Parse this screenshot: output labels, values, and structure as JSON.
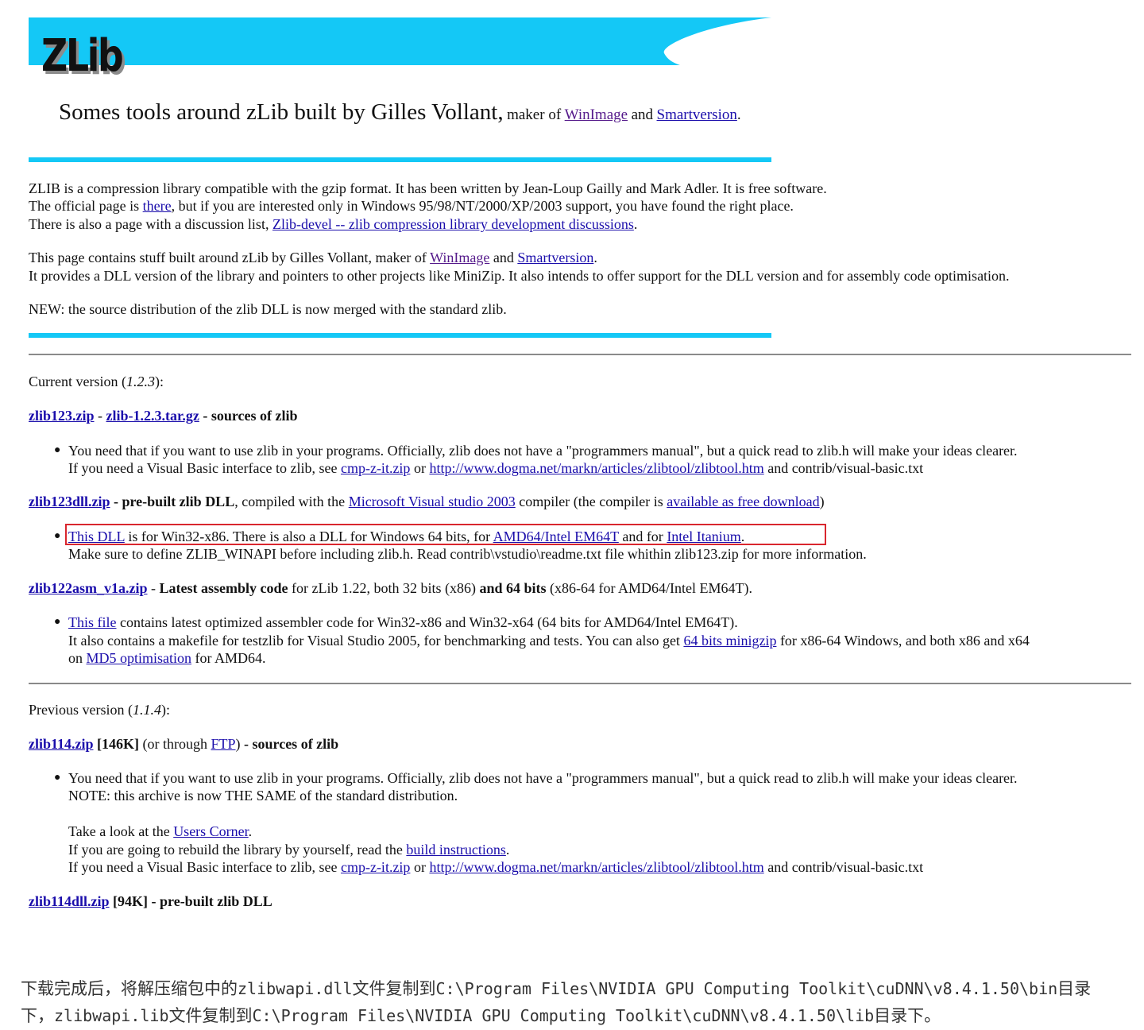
{
  "banner": {
    "logo_text": "ZLib",
    "tagline_large": "Somes tools around zLib built by Gilles Vollant,",
    "tagline_small": "maker of",
    "winimage": "WinImage",
    "and": "and",
    "smartversion": "Smartversion",
    "period": "."
  },
  "intro": {
    "p1": "ZLIB is a compression library compatible with the gzip format. It has been written by Jean-Loup Gailly and Mark Adler. It is free software.",
    "p2_a": "The official page is ",
    "p2_link": "there",
    "p2_b": ", but if you are interested only in Windows 95/98/NT/2000/XP/2003 support, you have found the right place.",
    "p3_a": "There is also a page with a discussion list, ",
    "p3_link": "Zlib-devel -- zlib compression library development discussions",
    "p3_b": ".",
    "p4_a": "This page contains stuff built around zLib by Gilles Vollant, maker of ",
    "p4_link1": "WinImage",
    "p4_and": " and ",
    "p4_link2": "Smartversion",
    "p4_b": ".",
    "p5": "It provides a DLL version of the library and pointers to other projects like MiniZip. It also intends to offer support for the DLL version and for assembly code optimisation.",
    "p6": "NEW: the source distribution of the zlib DLL is now merged with the standard zlib."
  },
  "current": {
    "heading_a": "Current version (",
    "version": "1.2.3",
    "heading_b": "):",
    "src": {
      "link1": "zlib123.zip",
      "sep": " - ",
      "link2": "zlib-1.2.3.tar.gz",
      "desc": " - sources of zlib",
      "bullet_l1": "You need that if you want to use zlib in your programs. Officially, zlib does not have a \"programmers manual\", but a quick read to zlib.h will make your ideas clearer.",
      "bullet_l2_a": "If you need a Visual Basic interface to zlib, see ",
      "bullet_l2_link1": "cmp-z-it.zip",
      "bullet_l2_or": " or ",
      "bullet_l2_link2": "http://www.dogma.net/markn/articles/zlibtool/zlibtool.htm",
      "bullet_l2_b": " and contrib/visual-basic.txt"
    },
    "dll": {
      "link": "zlib123dll.zip",
      "desc_bold": " - pre-built zlib DLL",
      "desc_a": ", compiled with the ",
      "link2": "Microsoft Visual studio 2003",
      "desc_b": " compiler (the compiler is ",
      "link3": "available as free download",
      "desc_c": ")",
      "bullet_link1": "This DLL",
      "bullet_a": " is for Win32-x86. There is also a DLL for Windows 64 bits, for ",
      "bullet_link2": "AMD64/Intel EM64T",
      "bullet_b": " and for ",
      "bullet_link3": "Intel Itanium",
      "bullet_c": ".",
      "bullet_l2": "Make sure to define ZLIB_WINAPI before including zlib.h. Read contrib\\vstudio\\readme.txt file whithin zlib123.zip for more information."
    },
    "asm": {
      "link": "zlib122asm_v1a.zip",
      "desc_a": " - ",
      "desc_bold": "Latest assembly code",
      "desc_b": " for zLib 1.22, both 32 bits (x86) ",
      "desc_bold2": "and 64 bits",
      "desc_c": " (x86-64 for AMD64/Intel EM64T).",
      "bullet_link": "This file",
      "bullet_a": " contains latest optimized assembler code for Win32-x86 and Win32-x64 (64 bits for AMD64/Intel EM64T).",
      "bullet_l2_a": "It also contains a makefile for testzlib for Visual Studio 2005, for benchmarking and tests. You can also get ",
      "bullet_l2_link": "64 bits minigzip",
      "bullet_l2_b": " for x86-64 Windows, and both x86 and x64",
      "bullet_l3_a": "on ",
      "bullet_l3_link": "MD5 optimisation",
      "bullet_l3_b": " for AMD64."
    }
  },
  "previous": {
    "heading_a": "Previous version (",
    "version": "1.1.4",
    "heading_b": "):",
    "src": {
      "link": "zlib114.zip",
      "size": " [146K]",
      "via_a": " (or through ",
      "via_link": "FTP",
      "via_b": ")",
      "desc": " - sources of zlib",
      "bullet_l1": "You need that if you want to use zlib in your programs. Officially, zlib does not have a \"programmers manual\", but a quick read to zlib.h will make your ideas clearer.",
      "bullet_l2": "NOTE: this archive is now THE SAME of the standard distribution.",
      "bullet_l3_a": "Take a look at the ",
      "bullet_l3_link": "Users Corner",
      "bullet_l3_b": ".",
      "bullet_l4_a": "If you are going to rebuild the library by yourself, read the ",
      "bullet_l4_link": "build instructions",
      "bullet_l4_b": ".",
      "bullet_l5_a": "If you need a Visual Basic interface to zlib, see ",
      "bullet_l5_link1": "cmp-z-it.zip",
      "bullet_l5_or": " or ",
      "bullet_l5_link2": "http://www.dogma.net/markn/articles/zlibtool/zlibtool.htm",
      "bullet_l5_b": " and contrib/visual-basic.txt"
    },
    "dll": {
      "link": "zlib114dll.zip",
      "size": " [94K]",
      "desc": " - pre-built zlib DLL"
    }
  },
  "note": {
    "line1_a": "下载完成后，将解压缩包中的",
    "line1_code1": "zlibwapi.dll",
    "line1_b": "文件复制到",
    "line1_code2": "C:\\Program Files\\NVIDIA GPU Computing Toolkit\\cuDNN\\v8.4.1.50\\bin",
    "line1_c": "目录",
    "line2_a": "下，",
    "line2_code1": "zlibwapi.lib",
    "line2_b": "文件复制到",
    "line2_code2": "C:\\Program Files\\NVIDIA GPU Computing Toolkit\\cuDNN\\v8.4.1.50\\lib",
    "line2_c": "目录下。"
  },
  "colors": {
    "accent_cyan": "#14c8f6",
    "highlight_red": "#d9262e",
    "link": "#1a0dab",
    "visited": "#551a8b"
  }
}
